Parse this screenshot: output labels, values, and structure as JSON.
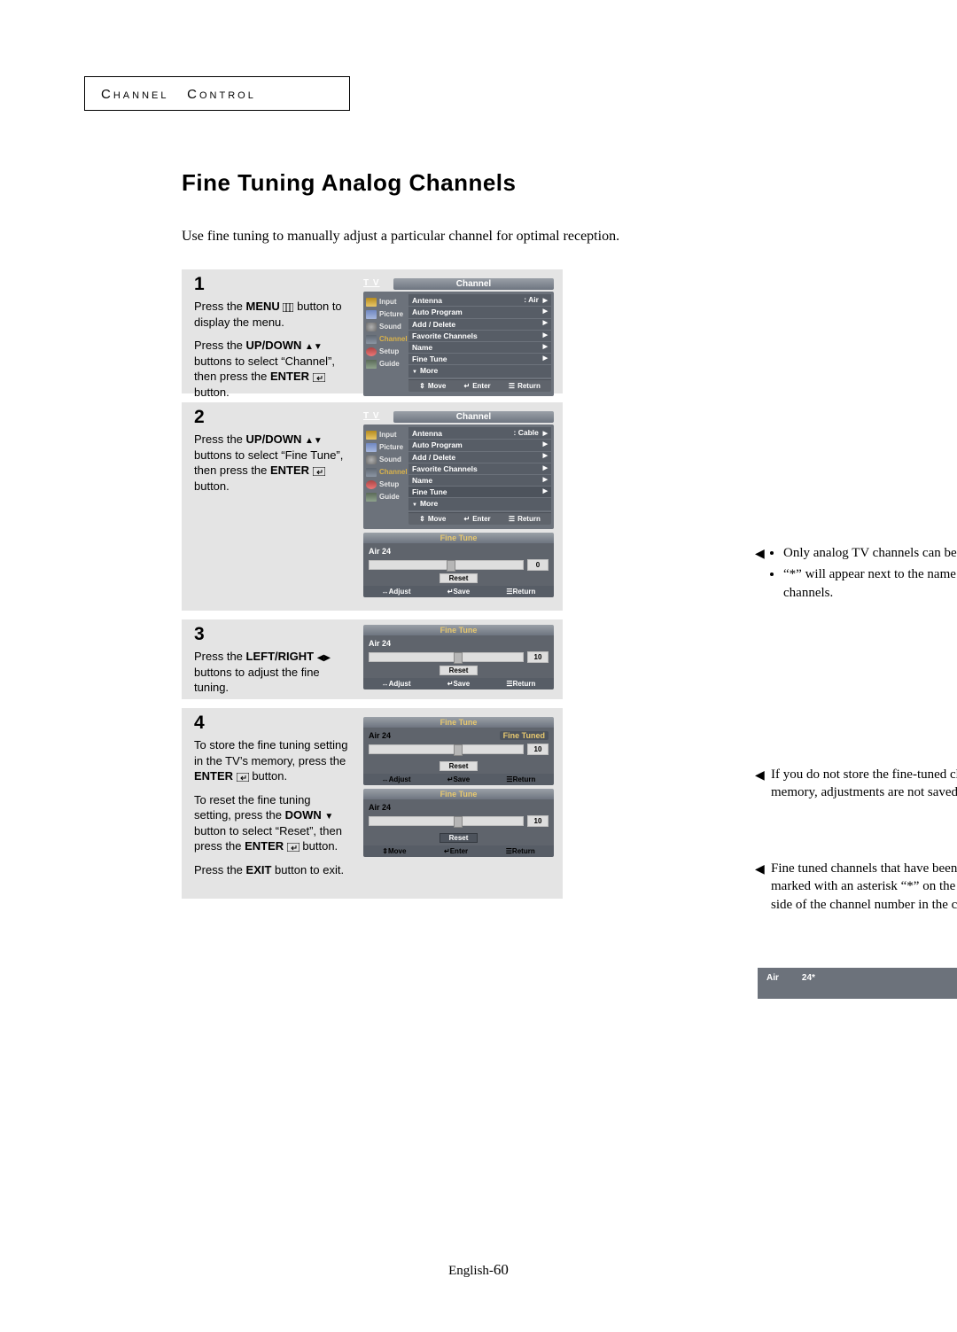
{
  "section_header": {
    "word1_cap": "C",
    "word1_rest": "HANNEL",
    "word2_cap": "C",
    "word2_rest": "ONTROL"
  },
  "title": "Fine Tuning Analog Channels",
  "intro": "Use fine tuning to manually adjust a particular channel for optimal reception.",
  "steps": {
    "s1": {
      "num": "1",
      "p1a": "Press the ",
      "p1b_bold": "MENU",
      "p1c": " button to display the menu.",
      "p2a": "Press the ",
      "p2b_bold": "UP/DOWN",
      "p2c": " buttons to select “Channel”, then press the ",
      "p2d_bold": "ENTER",
      "p2e": " button."
    },
    "s2": {
      "num": "2",
      "p1a": "Press the ",
      "p1b_bold": "UP/DOWN",
      "p1c": " buttons to select “Fine Tune”, then press the ",
      "p1d_bold": "ENTER",
      "p1e": " button."
    },
    "s3": {
      "num": "3",
      "p1a": "Press the ",
      "p1b_bold": "LEFT/RIGHT",
      "p1c": " buttons to adjust the fine tuning."
    },
    "s4": {
      "num": "4",
      "p1a": "To store the fine tuning setting in the TV’s memory, press the ",
      "p1b_bold": "ENTER",
      "p1c": " button.",
      "p2a": "To reset the fine tuning setting, press the ",
      "p2b_bold": "DOWN",
      "p2c": " button to select “Reset”, then press  the ",
      "p2d_bold": "ENTER",
      "p2e": " button.",
      "p3a": "Press the ",
      "p3b_bold": "EXIT",
      "p3c": " button to exit."
    }
  },
  "osd": {
    "tv": "T V",
    "channel_tab": "Channel",
    "sidebar": [
      "Input",
      "Picture",
      "Sound",
      "Channel",
      "Setup",
      "Guide"
    ],
    "menu1": [
      {
        "label": "Antenna",
        "value": ": Air",
        "arr": true
      },
      {
        "label": "Auto Program",
        "arr": true
      },
      {
        "label": "Add / Delete",
        "arr": true
      },
      {
        "label": "Favorite Channels",
        "arr": true
      },
      {
        "label": "Name",
        "arr": true
      },
      {
        "label": "Fine Tune",
        "arr": true
      },
      {
        "label": "More",
        "more": true
      }
    ],
    "menu2": [
      {
        "label": "Antenna",
        "value": ": Cable",
        "arr": true
      },
      {
        "label": "Auto Program",
        "arr": true
      },
      {
        "label": "Add / Delete",
        "arr": true
      },
      {
        "label": "Favorite Channels",
        "arr": true
      },
      {
        "label": "Name",
        "arr": true
      },
      {
        "label": "Fine Tune",
        "arr": true,
        "hl": true
      },
      {
        "label": "More",
        "more": true
      }
    ],
    "hints_menu": [
      "Move",
      "Enter",
      "Return"
    ],
    "hints_ft": [
      "Adjust",
      "Save",
      "Return"
    ],
    "hints_reset": [
      "Move",
      "Enter",
      "Return"
    ],
    "ft": {
      "title": "Fine Tune",
      "ch": "Air 24",
      "label": "Fine Tuned",
      "reset": "Reset",
      "val0": "0",
      "val10": "10"
    }
  },
  "notes": {
    "n1a": "Only analog TV channels can be fine tuned.",
    "n1b": "“*” will appear next to the name  of fine-tuned channels.",
    "n2": "If you do not store the fine-tuned channel in memory, adjustments are not saved.",
    "n3": "Fine tuned channels that have been saved are marked with an asterisk “*” on the right-hand side of the channel number in the channel banner."
  },
  "banner": {
    "air": "Air",
    "num": "24*"
  },
  "pagenum": {
    "a": "English-",
    "b": "60"
  }
}
